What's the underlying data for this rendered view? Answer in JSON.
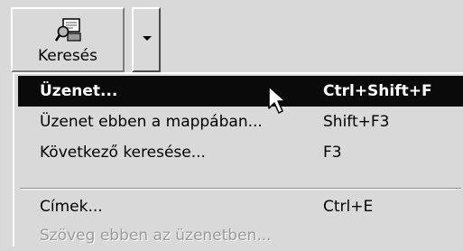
{
  "toolbar": {
    "search_button": {
      "label": "Keresés",
      "icon": "find-message-icon"
    },
    "dropdown_icon": "chevron-down-icon"
  },
  "menu": {
    "items": [
      {
        "label": "Üzenet...",
        "shortcut": "Ctrl+Shift+F",
        "state": "selected"
      },
      {
        "label": "Üzenet ebben a mappában...",
        "shortcut": "Shift+F3",
        "state": "enabled"
      },
      {
        "label": "Következő keresése...",
        "shortcut": "F3",
        "state": "enabled"
      },
      {
        "label": "Címek...",
        "shortcut": "Ctrl+E",
        "state": "enabled"
      },
      {
        "label": "Szöveg ebben az üzenetben...",
        "shortcut": "",
        "state": "disabled"
      }
    ]
  },
  "cursor_icon": "mouse-pointer-icon",
  "colors": {
    "selection": "#0a0a0a",
    "face": "#d9d9d9",
    "disabled": "#9a9a9a"
  }
}
